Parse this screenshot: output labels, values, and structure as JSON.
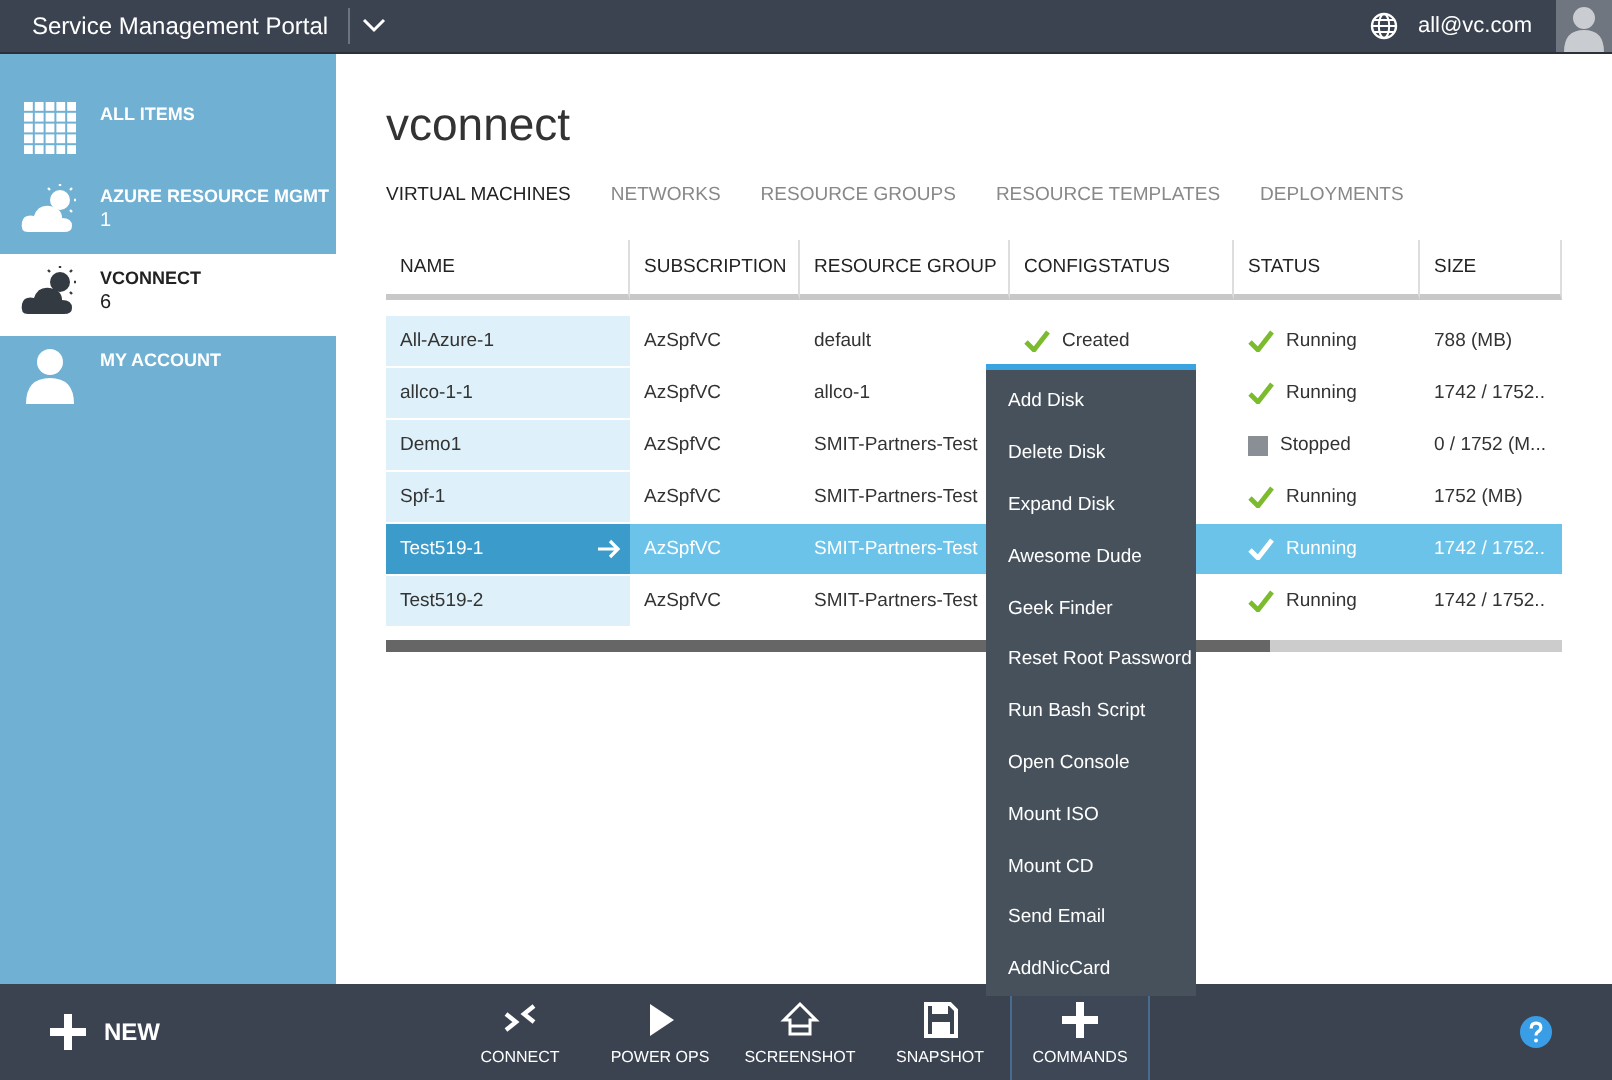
{
  "header": {
    "title": "Service Management Portal",
    "user": "all@vc.com"
  },
  "sidebar": {
    "items": [
      {
        "label": "ALL ITEMS",
        "kind": "grid",
        "selected": false
      },
      {
        "label": "AZURE RESOURCE MGMT",
        "count": "1",
        "kind": "cloud",
        "selected": false
      },
      {
        "label": "VCONNECT",
        "count": "6",
        "kind": "cloud",
        "selected": true
      },
      {
        "label": "MY ACCOUNT",
        "kind": "person",
        "selected": false
      }
    ]
  },
  "page": {
    "title": "vconnect",
    "tabs": [
      {
        "label": "VIRTUAL MACHINES",
        "selected": true
      },
      {
        "label": "NETWORKS",
        "selected": false
      },
      {
        "label": "RESOURCE GROUPS",
        "selected": false
      },
      {
        "label": "RESOURCE TEMPLATES",
        "selected": false
      },
      {
        "label": "DEPLOYMENTS",
        "selected": false
      }
    ]
  },
  "table": {
    "columns": [
      "NAME",
      "SUBSCRIPTION",
      "RESOURCE GROUP",
      "CONFIGSTATUS",
      "STATUS",
      "SIZE"
    ],
    "rows": [
      {
        "name": "All-Azure-1",
        "subscription": "AzSpfVC",
        "resource_group": "default",
        "configstatus": "Created",
        "status": "Running",
        "kind": "running",
        "size": "788 (MB)",
        "selected": false
      },
      {
        "name": "allco-1-1",
        "subscription": "AzSpfVC",
        "resource_group": "allco-1",
        "status": "Running",
        "kind": "running",
        "size": "1742 / 1752..",
        "selected": false
      },
      {
        "name": "Demo1",
        "subscription": "AzSpfVC",
        "resource_group": "SMIT-Partners-Test",
        "status": "Stopped",
        "kind": "stopped",
        "size": "0 / 1752 (M...",
        "selected": false
      },
      {
        "name": "Spf-1",
        "subscription": "AzSpfVC",
        "resource_group": "SMIT-Partners-Test",
        "status": "Running",
        "kind": "running",
        "size": "1752 (MB)",
        "selected": false
      },
      {
        "name": "Test519-1",
        "subscription": "AzSpfVC",
        "resource_group": "SMIT-Partners-Test",
        "status": "Running",
        "kind": "running",
        "size": "1742 / 1752..",
        "selected": true
      },
      {
        "name": "Test519-2",
        "subscription": "AzSpfVC",
        "resource_group": "SMIT-Partners-Test",
        "status": "Running",
        "kind": "running",
        "size": "1742 / 1752..",
        "selected": false
      }
    ]
  },
  "context_menu": {
    "items": [
      "Add Disk",
      "Delete Disk",
      "Expand Disk",
      "Awesome Dude",
      "Geek Finder",
      "Reset Root Password",
      "Run Bash Script",
      "Open Console",
      "Mount ISO",
      "Mount CD",
      "Send Email",
      "AddNicCard"
    ]
  },
  "command_bar": {
    "new_label": "NEW",
    "buttons": [
      {
        "label": "CONNECT",
        "kind": "connect",
        "selected": false
      },
      {
        "label": "POWER OPS",
        "kind": "play",
        "selected": false
      },
      {
        "label": "SCREENSHOT",
        "kind": "screenshot",
        "selected": false
      },
      {
        "label": "SNAPSHOT",
        "kind": "snapshot",
        "selected": false
      },
      {
        "label": "COMMANDS",
        "kind": "plus",
        "selected": true
      }
    ]
  }
}
